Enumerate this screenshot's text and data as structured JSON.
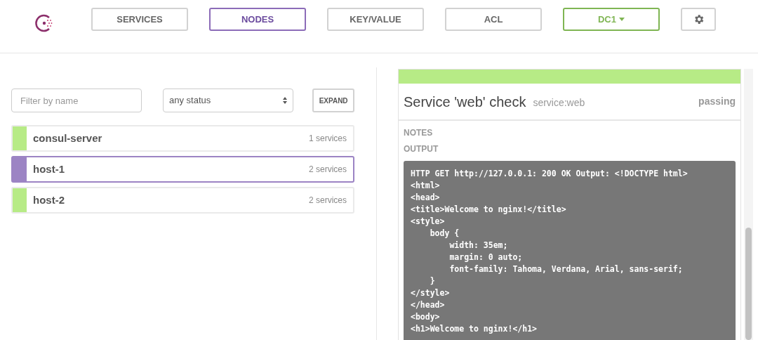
{
  "nav": {
    "tabs": [
      {
        "label": "SERVICES",
        "selected": false
      },
      {
        "label": "NODES",
        "selected": true
      },
      {
        "label": "KEY/VALUE",
        "selected": false
      },
      {
        "label": "ACL",
        "selected": false
      }
    ],
    "datacenter": {
      "label": "DC1"
    }
  },
  "filters": {
    "name": {
      "placeholder": "Filter by name"
    },
    "status": {
      "value": "any status"
    },
    "expand_button": "EXPAND"
  },
  "nodes": [
    {
      "name": "consul-server",
      "services": "1 services",
      "color": "#b7eb86",
      "selected": false
    },
    {
      "name": "host-1",
      "services": "2 services",
      "color": "#9c84c4",
      "selected": true
    },
    {
      "name": "host-2",
      "services": "2 services",
      "color": "#b7eb86",
      "selected": false
    }
  ],
  "check": {
    "color": "#b7eb86",
    "title": "Service 'web' check",
    "service": "service:web",
    "status": "passing",
    "notes_label": "NOTES",
    "output_label": "OUTPUT",
    "output_lines": [
      "HTTP GET http://127.0.0.1: 200 OK Output: <!DOCTYPE html>",
      "<html>",
      "<head>",
      "<title>Welcome to nginx!</title>",
      "<style>",
      "    body {",
      "        width: 35em;",
      "        margin: 0 auto;",
      "        font-family: Tahoma, Verdana, Arial, sans-serif;",
      "    }",
      "</style>",
      "</head>",
      "<body>",
      "<h1>Welcome to nginx!</h1>"
    ]
  }
}
